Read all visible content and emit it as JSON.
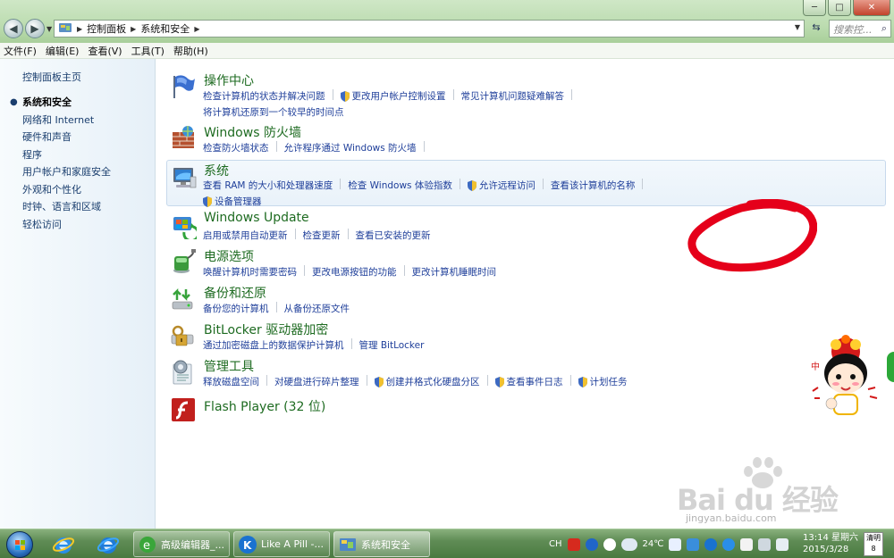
{
  "window": {
    "controls": {
      "minimize": "─",
      "maximize": "□",
      "close": "✕"
    }
  },
  "address": {
    "crumbs": [
      "控制面板",
      "系统和安全"
    ],
    "search_placeholder": "搜索控..."
  },
  "menu": [
    "文件(F)",
    "编辑(E)",
    "查看(V)",
    "工具(T)",
    "帮助(H)"
  ],
  "sidebar": {
    "home": "控制面板主页",
    "items": [
      {
        "label": "系统和安全",
        "current": true
      },
      {
        "label": "网络和 Internet"
      },
      {
        "label": "硬件和声音"
      },
      {
        "label": "程序"
      },
      {
        "label": "用户帐户和家庭安全"
      },
      {
        "label": "外观和个性化"
      },
      {
        "label": "时钟、语言和区域"
      },
      {
        "label": "轻松访问"
      }
    ]
  },
  "categories": [
    {
      "title": "操作中心",
      "icon": "action-center-flag-icon",
      "links": [
        "检查计算机的状态并解决问题",
        "更改用户帐户控制设置",
        "常见计算机问题疑难解答",
        "将计算机还原到一个较早的时间点"
      ]
    },
    {
      "title": "Windows 防火墙",
      "icon": "firewall-icon",
      "links": [
        "检查防火墙状态",
        "允许程序通过 Windows 防火墙"
      ]
    },
    {
      "title": "系统",
      "icon": "system-computer-icon",
      "links": [
        "查看 RAM 的大小和处理器速度",
        "检查 Windows 体验指数",
        "允许远程访问",
        "查看该计算机的名称",
        "设备管理器"
      ]
    },
    {
      "title": "Windows Update",
      "icon": "windows-update-icon",
      "links": [
        "启用或禁用自动更新",
        "检查更新",
        "查看已安装的更新"
      ]
    },
    {
      "title": "电源选项",
      "icon": "power-options-icon",
      "links": [
        "唤醒计算机时需要密码",
        "更改电源按钮的功能",
        "更改计算机睡眠时间"
      ]
    },
    {
      "title": "备份和还原",
      "icon": "backup-restore-icon",
      "links": [
        "备份您的计算机",
        "从备份还原文件"
      ]
    },
    {
      "title": "BitLocker 驱动器加密",
      "icon": "bitlocker-icon",
      "links": [
        "通过加密磁盘上的数据保护计算机",
        "管理 BitLocker"
      ]
    },
    {
      "title": "管理工具",
      "icon": "admin-tools-icon",
      "links": [
        "释放磁盘空间",
        "对硬盘进行碎片整理",
        "创建并格式化硬盘分区",
        "查看事件日志",
        "计划任务"
      ]
    },
    {
      "title": "Flash Player (32 位)",
      "icon": "flash-player-icon",
      "links": []
    }
  ],
  "watermark": {
    "text": "Bai du 经验",
    "sub": "jingyan.baidu.com"
  },
  "taskbar": {
    "tasks": [
      {
        "label": "高级编辑器_..."
      },
      {
        "label": "Like A Pill -..."
      },
      {
        "label": "系统和安全"
      }
    ],
    "tray": {
      "lang": "CH",
      "temp": "24℃"
    },
    "clock": {
      "time": "13:14 星期六",
      "date": "2015/3/28"
    },
    "weather": {
      "cond": "清明",
      "num": "8"
    }
  }
}
